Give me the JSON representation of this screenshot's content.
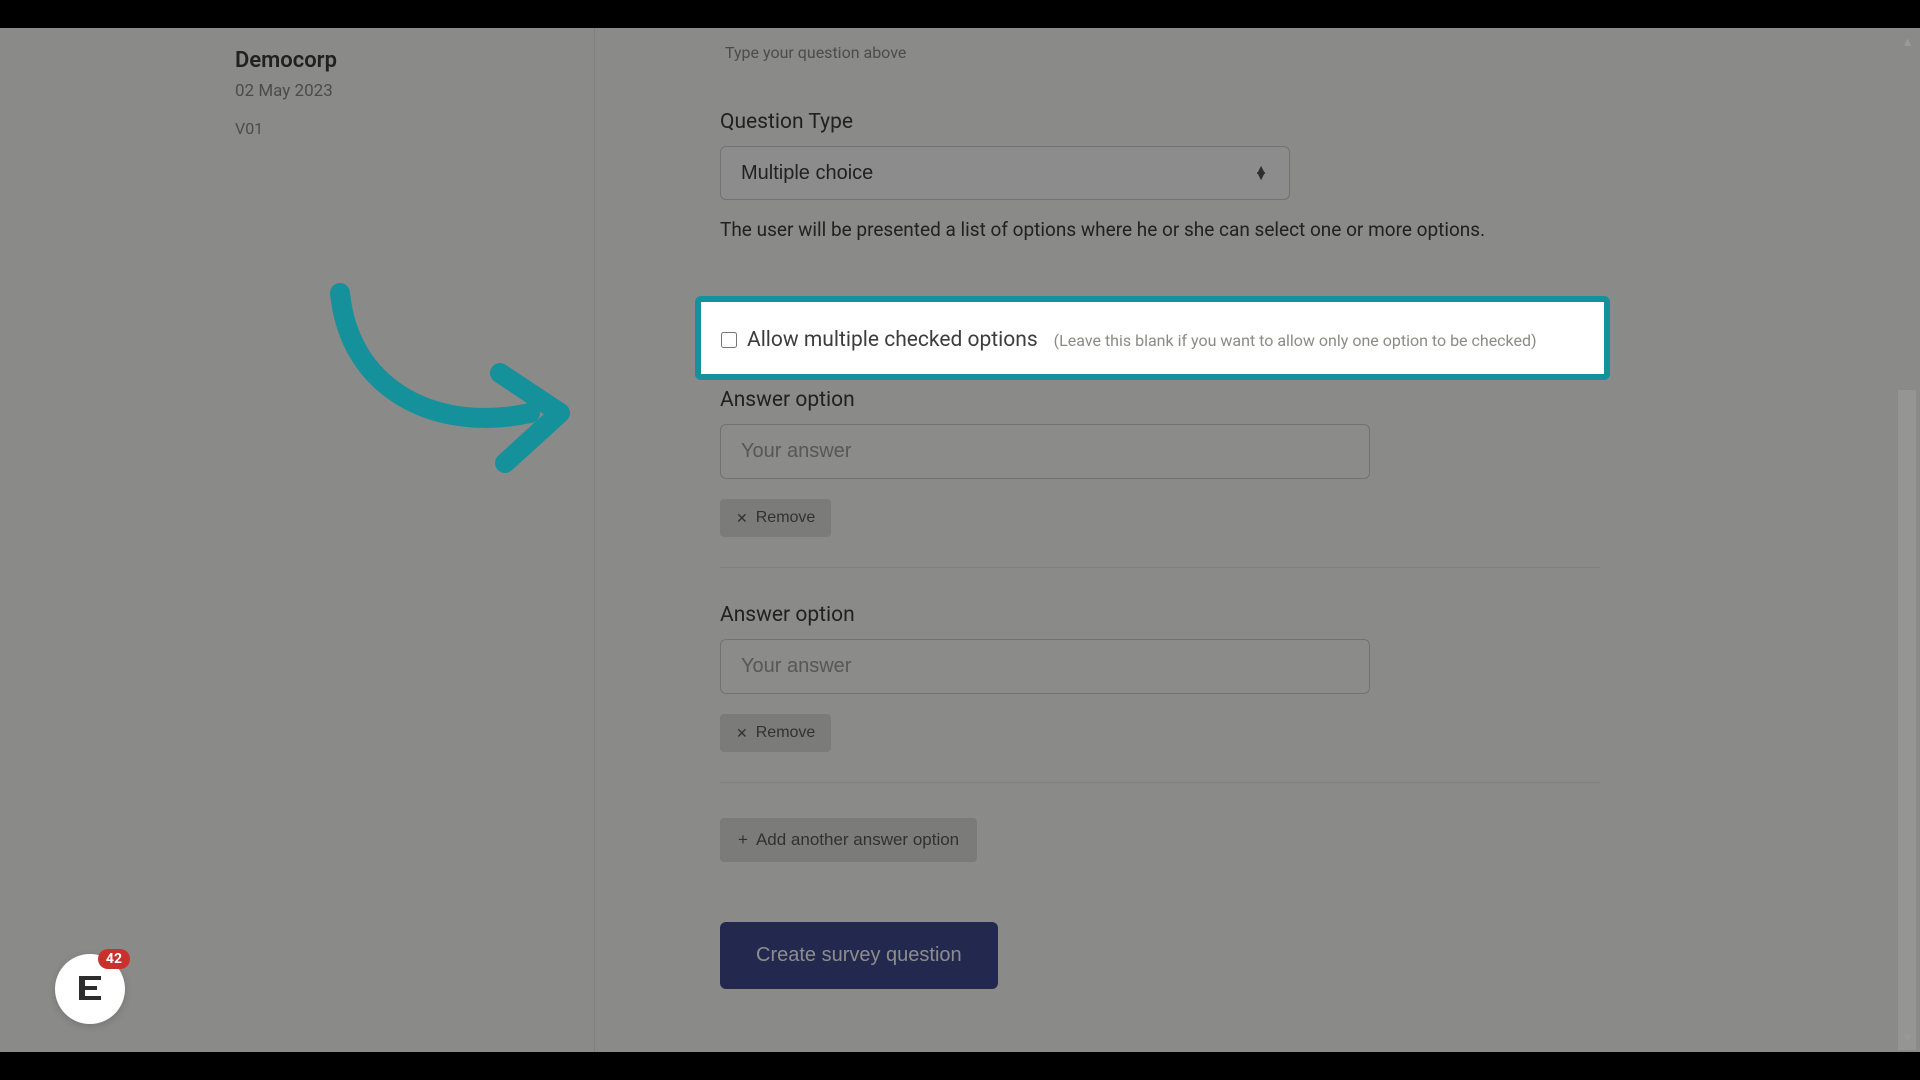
{
  "sidebar": {
    "title": "Democorp",
    "date": "02 May 2023",
    "version": "V01"
  },
  "main": {
    "hint": "Type your question above",
    "question_type_label": "Question Type",
    "question_type_value": "Multiple choice",
    "description": "The user will be presented a list of options where he or she can select one or more options.",
    "allow_multiple_label": "Allow multiple checked options",
    "allow_multiple_hint": "(Leave this blank if you want to allow only one option to be checked)",
    "answer_label": "Answer option",
    "answer_placeholder": "Your answer",
    "remove_label": "Remove",
    "add_label": "Add another answer option",
    "submit_label": "Create survey question"
  },
  "chat": {
    "badge": "42"
  }
}
